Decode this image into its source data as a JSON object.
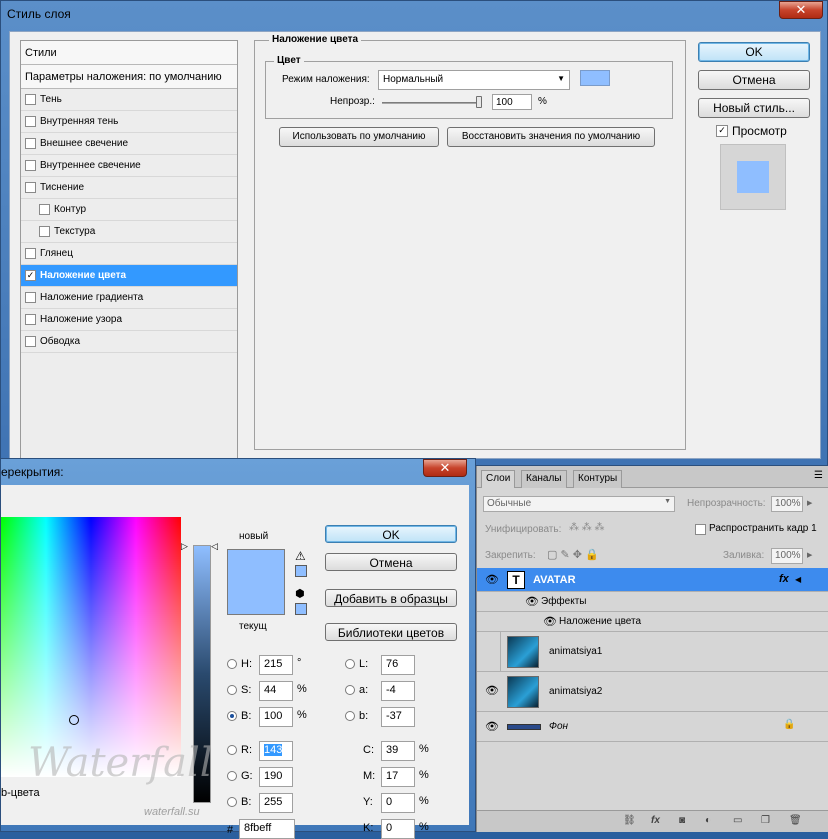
{
  "layer_style": {
    "title": "Стиль слоя",
    "styles_header": "Стили",
    "blend_defaults": "Параметры наложения: по умолчанию",
    "items": [
      {
        "label": "Тень",
        "checked": false,
        "sub": false,
        "selected": false
      },
      {
        "label": "Внутренняя тень",
        "checked": false,
        "sub": false,
        "selected": false
      },
      {
        "label": "Внешнее свечение",
        "checked": false,
        "sub": false,
        "selected": false
      },
      {
        "label": "Внутреннее свечение",
        "checked": false,
        "sub": false,
        "selected": false
      },
      {
        "label": "Тиснение",
        "checked": false,
        "sub": false,
        "selected": false
      },
      {
        "label": "Контур",
        "checked": false,
        "sub": true,
        "selected": false
      },
      {
        "label": "Текстура",
        "checked": false,
        "sub": true,
        "selected": false
      },
      {
        "label": "Глянец",
        "checked": false,
        "sub": false,
        "selected": false
      },
      {
        "label": "Наложение цвета",
        "checked": true,
        "sub": false,
        "selected": true
      },
      {
        "label": "Наложение градиента",
        "checked": false,
        "sub": false,
        "selected": false
      },
      {
        "label": "Наложение узора",
        "checked": false,
        "sub": false,
        "selected": false
      },
      {
        "label": "Обводка",
        "checked": false,
        "sub": false,
        "selected": false
      }
    ],
    "group_title": "Наложение цвета",
    "subgroup_title": "Цвет",
    "blend_mode_label": "Режим наложения:",
    "blend_mode_value": "Нормальный",
    "opacity_label": "Непрозр.:",
    "opacity_value": "100",
    "opacity_unit": "%",
    "opacity_level": 1.0,
    "btn_use_default": "Использовать по умолчанию",
    "btn_restore_default": "Восстановить значения по умолчанию",
    "btn_ok": "OK",
    "btn_cancel": "Отмена",
    "btn_new_style": "Новый стиль...",
    "preview_checked": true,
    "preview_label": "Просмотр",
    "overlay_color": "#8fbeff"
  },
  "color_picker": {
    "title_partial": "ерекрытия:",
    "new_label": "новый",
    "current_label": "текущ",
    "btn_ok": "OK",
    "btn_cancel": "Отмена",
    "btn_add_swatches": "Добавить в образцы",
    "btn_libraries": "Библиотеки цветов",
    "h": {
      "label": "H:",
      "value": "215",
      "unit": "°"
    },
    "s": {
      "label": "S:",
      "value": "44",
      "unit": "%"
    },
    "b": {
      "label": "B:",
      "value": "100",
      "unit": "%"
    },
    "r": {
      "label": "R:",
      "value": "143"
    },
    "g": {
      "label": "G:",
      "value": "190"
    },
    "bl": {
      "label": "B:",
      "value": "255"
    },
    "l": {
      "label": "L:",
      "value": "76"
    },
    "a": {
      "label": "a:",
      "value": "-4"
    },
    "lb": {
      "label": "b:",
      "value": "-37"
    },
    "c": {
      "label": "C:",
      "value": "39",
      "unit": "%"
    },
    "m": {
      "label": "M:",
      "value": "17",
      "unit": "%"
    },
    "y": {
      "label": "Y:",
      "value": "0",
      "unit": "%"
    },
    "k": {
      "label": "K:",
      "value": "0",
      "unit": "%"
    },
    "hex_label": "#",
    "hex_value": "8fbeff",
    "web_label_partial": "b-цвета",
    "color": "#8fbeff"
  },
  "layers_panel": {
    "tabs": [
      "Слои",
      "Каналы",
      "Контуры"
    ],
    "blend_mode": "Обычные",
    "opacity_label": "Непрозрачность:",
    "opacity_value": "100%",
    "unify_label": "Унифицировать:",
    "propagate_label": "Распространить кадр 1",
    "lock_label": "Закрепить:",
    "fill_label": "Заливка:",
    "fill_value": "100%",
    "layers": [
      {
        "name": "AVATAR",
        "type": "text",
        "selected": true,
        "visible": true
      },
      {
        "name": "Эффекты",
        "type": "effects",
        "selected": false,
        "visible": true
      },
      {
        "name": "Наложение цвета",
        "type": "effect-item",
        "selected": false,
        "visible": true
      },
      {
        "name": "animatsiya1",
        "type": "smart",
        "selected": false,
        "visible": false
      },
      {
        "name": "animatsiya2",
        "type": "smart",
        "selected": false,
        "visible": true
      },
      {
        "name": "Фон",
        "type": "background",
        "selected": false,
        "visible": true
      }
    ],
    "fx_label": "fx"
  },
  "watermark": {
    "brand": "Waterfall",
    "url": "waterfall.su"
  }
}
